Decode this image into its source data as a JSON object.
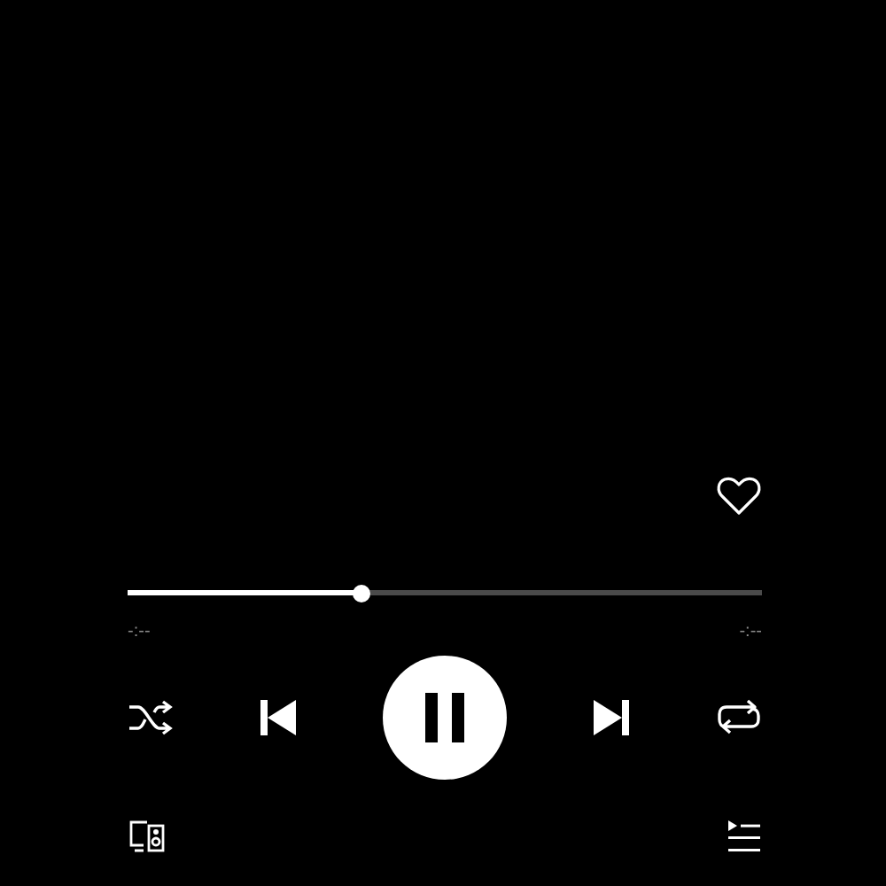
{
  "player": {
    "liked": false,
    "playing": true,
    "shuffle": false,
    "repeat": false
  },
  "progress": {
    "level": 0.37,
    "elapsed": "-:--",
    "remaining": "-:--"
  }
}
